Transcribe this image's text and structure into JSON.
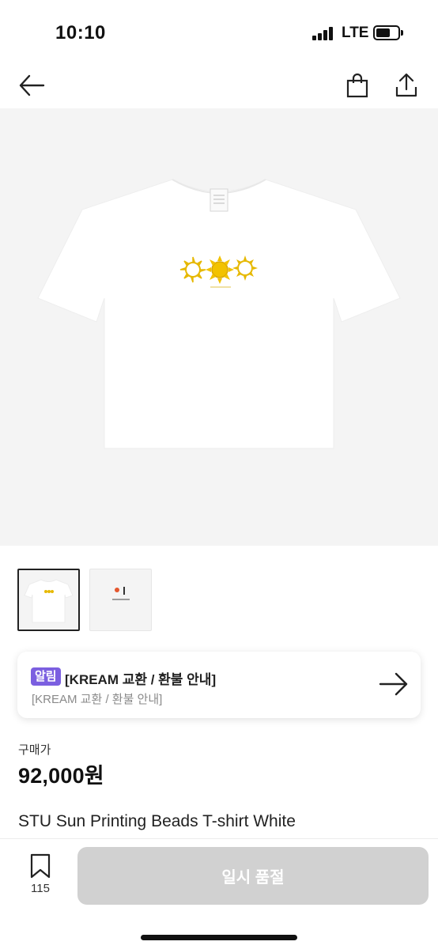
{
  "status_bar": {
    "time": "10:10",
    "network": "LTE",
    "battery_level": 0.6
  },
  "nav": {
    "icons": [
      "back-arrow-icon",
      "shopping-bag-icon",
      "share-icon"
    ]
  },
  "gallery": {
    "thumbnail_count": 2,
    "selected_index": 0
  },
  "notice": {
    "badge": "알림",
    "title": "[KREAM 교환 / 환불 안내]",
    "subtitle": "[KREAM 교환 / 환불 안내]"
  },
  "price": {
    "label": "구매가",
    "value": "92,000원"
  },
  "product": {
    "name": "STU Sun Printing Beads T-shirt White"
  },
  "bottom_bar": {
    "bookmark_count": "115",
    "action_label": "일시 품절"
  },
  "colors": {
    "badge": "#7b5fe0",
    "sun_print": "#e6b800",
    "disabled_button": "#d1d1d1"
  }
}
